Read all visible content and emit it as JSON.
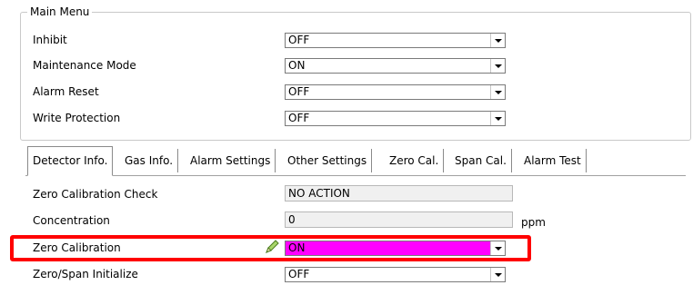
{
  "main_menu": {
    "title": "Main Menu",
    "rows": [
      {
        "label": "Inhibit",
        "value": "OFF"
      },
      {
        "label": "Maintenance Mode",
        "value": "ON"
      },
      {
        "label": "Alarm Reset",
        "value": "OFF"
      },
      {
        "label": "Write Protection",
        "value": "OFF"
      }
    ]
  },
  "tabs": [
    {
      "label": "Detector Info.",
      "active": true
    },
    {
      "label": "Gas Info."
    },
    {
      "label": "Alarm Settings"
    },
    {
      "label": "Other Settings"
    },
    {
      "label": "Zero Cal."
    },
    {
      "label": "Span Cal."
    },
    {
      "label": "Alarm Test"
    }
  ],
  "detector_info": {
    "zero_calibration_check": {
      "label": "Zero Calibration Check",
      "value": "NO ACTION"
    },
    "concentration": {
      "label": "Concentration",
      "value": "0",
      "unit": "ppm"
    },
    "zero_calibration": {
      "label": "Zero Calibration",
      "value": "ON",
      "highlight_color": "#ff00ff",
      "edit_icon": "pencil-icon"
    },
    "zero_span_initialize": {
      "label": "Zero/Span Initialize",
      "value": "OFF"
    }
  },
  "annotation": {
    "color": "#ff0000"
  }
}
